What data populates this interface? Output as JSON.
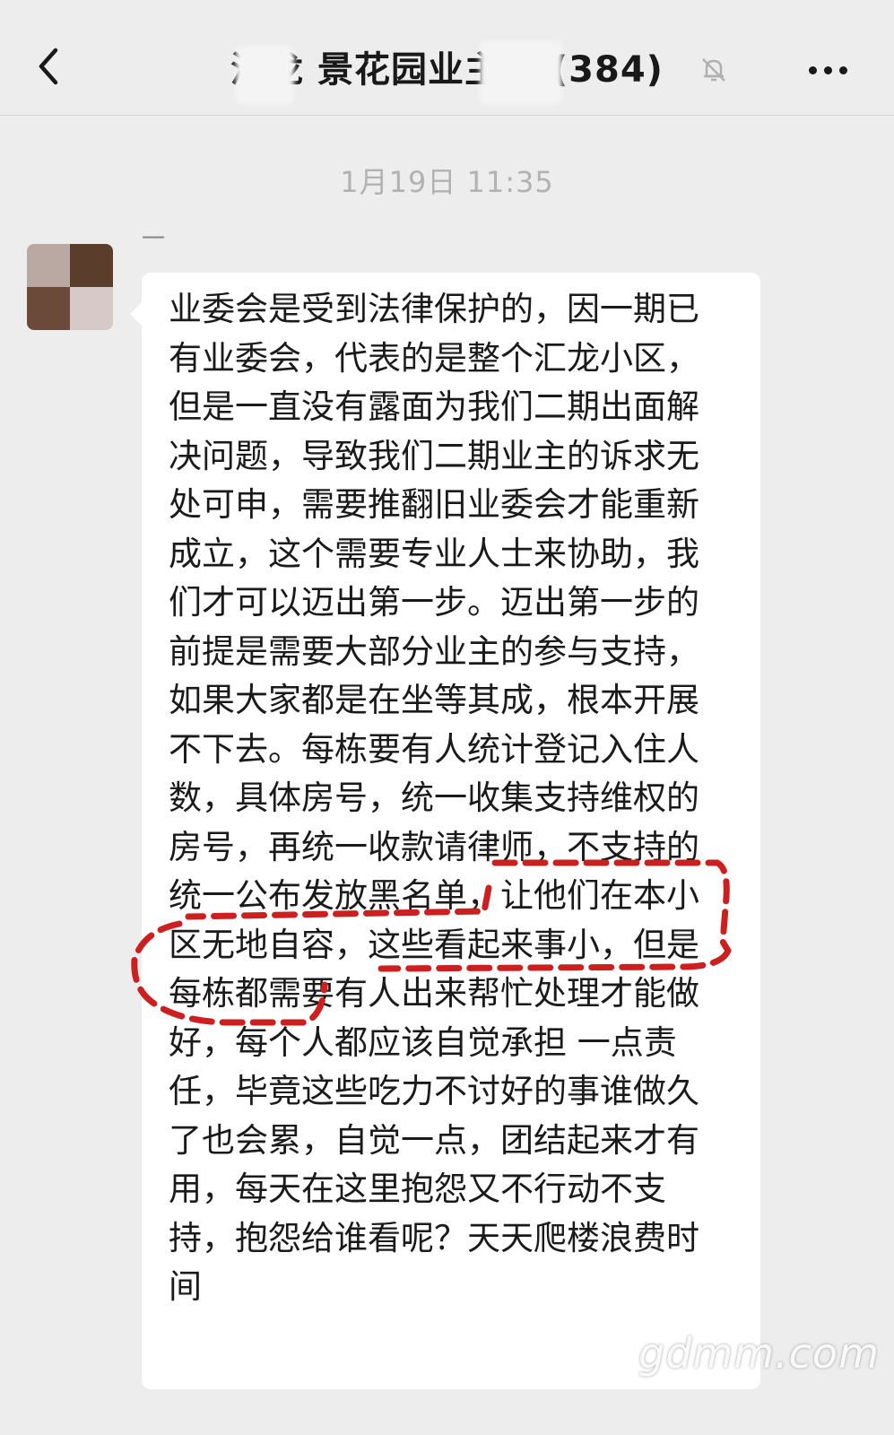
{
  "header": {
    "title": "汇龙 景花园业主 群(384)",
    "back_icon": "chevron-left-icon",
    "mute_icon": "bell-off-icon",
    "more_icon": "more-dots-icon"
  },
  "chat": {
    "timestamp": "1月19日 11:35",
    "messages": [
      {
        "sender": "一",
        "text": "业委会是受到法律保护的，因一期已有业委会，代表的是整个汇龙小区，但是一直没有露面为我们二期出面解决问题，导致我们二期业主的诉求无处可申，需要推翻旧业委会才能重新成立，这个需要专业人士来协助，我们才可以迈出第一步。迈出第一步的前提是需要大部分业主的参与支持，如果大家都是在坐等其成，根本开展不下去。每栋要有人统计登记入住人数，具体房号，统一收集支持维权的房号，再统一收款请律师，不支持的统一公布发放黑名单，让他们在本小区无地自容，这些看起来事小，但是每栋都需要有人出来帮忙处理才能做好，每个人都应该自觉承担 一点责任，毕竟这些吃力不讨好的事谁做久了也会累，自觉一点，团结起来才有用，每天在这里抱怨又不行动不支持，抱怨给谁看呢？天天爬楼浪费时间"
      }
    ]
  },
  "watermark": "gdmm.com",
  "colors": {
    "background": "#ededed",
    "bubble": "#ffffff",
    "annotation": "#cc1f1f"
  }
}
